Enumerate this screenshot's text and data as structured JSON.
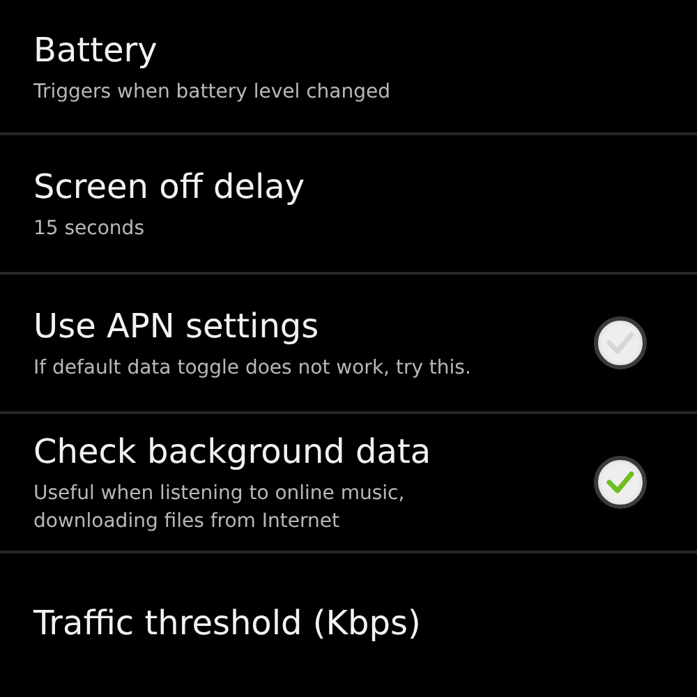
{
  "settings": [
    {
      "kind": "text",
      "title": "Battery",
      "summary": [
        "Triggers when battery level changed"
      ]
    },
    {
      "kind": "text",
      "title": "Screen off delay",
      "summary": [
        "15 seconds"
      ]
    },
    {
      "kind": "checkbox",
      "title": "Use APN settings",
      "summary": [
        "If default data toggle does not work, try this."
      ],
      "checked": false
    },
    {
      "kind": "checkbox",
      "title": "Check background data",
      "summary": [
        "Useful when listening to online music,",
        "downloading files from Internet"
      ],
      "checked": true
    },
    {
      "kind": "text",
      "title": "Traffic threshold (Kbps)"
    }
  ]
}
